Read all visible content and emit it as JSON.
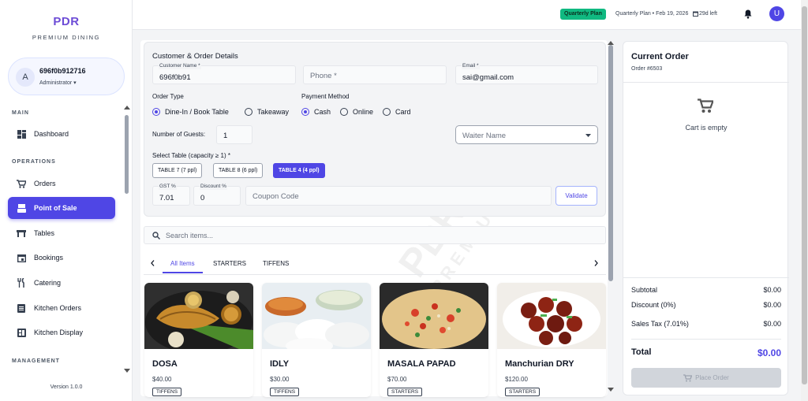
{
  "sidebar": {
    "brand": "PDR",
    "brand_sub": "PREMIUM DINING",
    "user": {
      "initial": "A",
      "name": "696f0b912716",
      "role": "Administrator ▾"
    },
    "sections": {
      "main": "MAIN",
      "operations": "OPERATIONS",
      "management": "MANAGEMENT"
    },
    "items": [
      {
        "label": "Dashboard",
        "icon": "dashboard-icon"
      },
      {
        "label": "Orders",
        "icon": "cart-icon"
      },
      {
        "label": "Point of Sale",
        "icon": "pos-icon"
      },
      {
        "label": "Tables",
        "icon": "table-icon"
      },
      {
        "label": "Bookings",
        "icon": "calendar-icon"
      },
      {
        "label": "Catering",
        "icon": "cutlery-icon"
      },
      {
        "label": "Kitchen Orders",
        "icon": "list-icon"
      },
      {
        "label": "Kitchen Display",
        "icon": "display-icon"
      }
    ],
    "version": "Version 1.0.0"
  },
  "topbar": {
    "badge": "Quarterly Plan",
    "plan": "Quarterly Plan • Feb 19, 2026",
    "days_left": "29d left",
    "user_initial": "U"
  },
  "details": {
    "heading": "Customer & Order Details",
    "customer_name": {
      "label": "Customer Name *",
      "value": "696f0b91"
    },
    "phone": {
      "placeholder": "Phone *"
    },
    "email": {
      "label": "Email *",
      "value": "sai@gmail.com"
    },
    "order_type": {
      "label": "Order Type",
      "options": [
        "Dine-In / Book Table",
        "Takeaway"
      ],
      "selected": "Dine-In / Book Table"
    },
    "payment": {
      "label": "Payment Method",
      "options": [
        "Cash",
        "Online",
        "Card"
      ],
      "selected": "Cash"
    },
    "guests": {
      "label": "Number of Guests:",
      "value": "1"
    },
    "waiter": {
      "placeholder": "Waiter Name"
    },
    "table": {
      "label": "Select Table (capacity ≥ 1) *",
      "options": [
        "TABLE 7 (7 ppl)",
        "TABLE 8 (6 ppl)",
        "TABLE 4 (4 ppl)"
      ],
      "selected": "TABLE 4 (4 ppl)"
    },
    "gst": {
      "label": "GST %",
      "value": "7.01"
    },
    "discount": {
      "label": "Discount %",
      "value": "0"
    },
    "coupon": {
      "placeholder": "Coupon Code"
    },
    "validate": "Validate"
  },
  "search": {
    "placeholder": "Search items..."
  },
  "tabs": [
    "All Items",
    "STARTERS",
    "TIFFENS"
  ],
  "menu_items": [
    {
      "name": "DOSA",
      "price": "$40.00",
      "tag": "TIFFENS"
    },
    {
      "name": "IDLY",
      "price": "$30.00",
      "tag": "TIFFENS"
    },
    {
      "name": "MASALA PAPAD",
      "price": "$70.00",
      "tag": "STARTERS"
    },
    {
      "name": "Manchurian DRY",
      "price": "$120.00",
      "tag": "STARTERS"
    }
  ],
  "watermark": {
    "line1": "PDR",
    "line2": "PREMIUM DINING"
  },
  "order": {
    "title": "Current Order",
    "number": "Order #6503",
    "empty": "Cart is empty",
    "subtotal": {
      "label": "Subtotal",
      "value": "$0.00"
    },
    "discount": {
      "label": "Discount (0%)",
      "value": "$0.00"
    },
    "tax": {
      "label": "Sales Tax (7.01%)",
      "value": "$0.00"
    },
    "total": {
      "label": "Total",
      "value": "$0.00"
    },
    "place": "Place Order"
  },
  "colors": {
    "accent": "#4f46e5",
    "brand": "#6d4cd6",
    "plan_badge": "#10b981"
  }
}
